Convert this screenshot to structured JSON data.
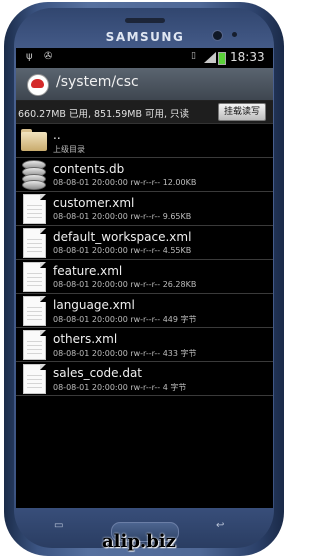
{
  "device": {
    "brand": "SAMSUNG",
    "watermark": "alip.biz"
  },
  "statusbar": {
    "time": "18:33"
  },
  "header": {
    "path": "/system/csc"
  },
  "storage": {
    "info": "660.27MB 已用, 851.59MB 可用, 只读",
    "button_label": "挂载读写"
  },
  "files": [
    {
      "name": "..",
      "meta": "上级目录",
      "icon": "folder-icon"
    },
    {
      "name": "contents.db",
      "meta": "08-08-01 20:00:00  rw-r--r--  12.00KB",
      "icon": "database-icon"
    },
    {
      "name": "customer.xml",
      "meta": "08-08-01 20:00:00  rw-r--r--  9.65KB",
      "icon": "file-icon"
    },
    {
      "name": "default_workspace.xml",
      "meta": "08-08-01 20:00:00  rw-r--r--  4.55KB",
      "icon": "file-icon"
    },
    {
      "name": "feature.xml",
      "meta": "08-08-01 20:00:00  rw-r--r--  26.28KB",
      "icon": "file-icon"
    },
    {
      "name": "language.xml",
      "meta": "08-08-01 20:00:00  rw-r--r--  449 字节",
      "icon": "file-icon"
    },
    {
      "name": "others.xml",
      "meta": "08-08-01 20:00:00  rw-r--r--  433 字节",
      "icon": "file-icon"
    },
    {
      "name": "sales_code.dat",
      "meta": "08-08-01 20:00:00  rw-r--r--  4 字节",
      "icon": "file-icon"
    }
  ],
  "colors": {
    "accent": "#d42a2a",
    "battery": "#5bd13a"
  }
}
